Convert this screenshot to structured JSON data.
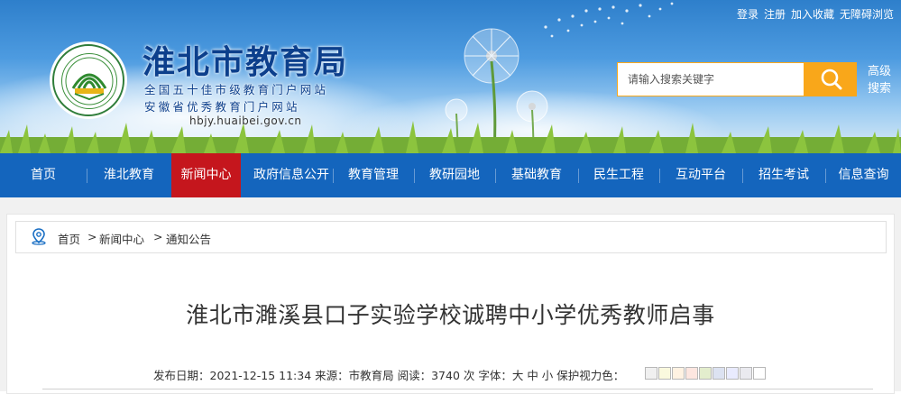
{
  "header": {
    "site_title": "淮北市教育局",
    "line1": "全国五十佳市级教育门户网站",
    "line2": "安徽省优秀教育门户网站",
    "url": "hbjy.huaibei.gov.cn",
    "top_links": [
      "登录",
      "注册",
      "加入收藏",
      "无障碍浏览"
    ],
    "search_placeholder": "请输入搜索关键字",
    "advanced_search": "高级搜索"
  },
  "nav": {
    "items": [
      "首页",
      "淮北教育",
      "新闻中心",
      "政府信息公开",
      "教育管理",
      "教研园地",
      "基础教育",
      "民生工程",
      "互动平台",
      "招生考试",
      "信息查询"
    ],
    "active_index": 2
  },
  "breadcrumb": {
    "items": [
      "首页",
      "新闻中心",
      "通知公告"
    ],
    "separator": ">"
  },
  "article": {
    "title": "淮北市濉溪县口子实验学校诚聘中小学优秀教师启事",
    "meta_text": "发布日期：2021-12-15 11:34  来源：市教育局  阅读：3740 次 字体：大 中 小 保护视力色：",
    "eye_colors": [
      "#f0f0f0",
      "#faf9de",
      "#fff2e2",
      "#fde6e0",
      "#e3edcd",
      "#dce2f1",
      "#e9ebfe",
      "#eaeaef",
      "#ffffff"
    ]
  },
  "colors": {
    "nav_bg": "#1465bd",
    "nav_active": "#c5161d",
    "search_button": "#f9a71a",
    "title_color": "#0c3f8c"
  },
  "icons": {
    "search": "magnifier-icon",
    "location": "map-pin-icon",
    "logo": "education-bureau-emblem"
  }
}
